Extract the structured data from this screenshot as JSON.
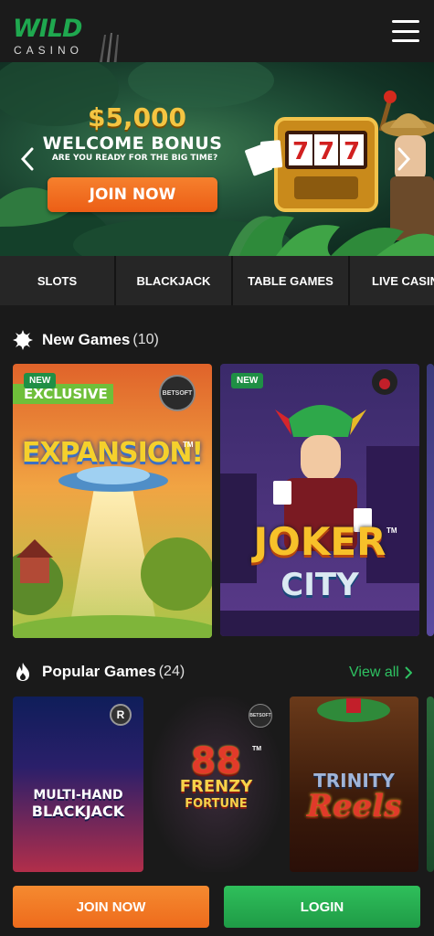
{
  "header": {
    "logo_wild": "WILD",
    "logo_casino": "CASINO",
    "menu_icon": "hamburger-menu-icon"
  },
  "hero": {
    "amount": "$5,000",
    "title": "WELCOME BONUS",
    "subtitle": "ARE YOU READY FOR THE BIG TIME?",
    "join_label": "JOIN NOW",
    "slot_reels": "777"
  },
  "tabs": [
    {
      "label": "SLOTS"
    },
    {
      "label": "BLACKJACK"
    },
    {
      "label": "TABLE GAMES"
    },
    {
      "label": "LIVE CASINO"
    }
  ],
  "new_games": {
    "title": "New Games",
    "count": "(10)",
    "icon": "starburst-icon",
    "cards": [
      {
        "badge": "NEW",
        "ribbon": "EXCLUSIVE",
        "provider": "BETSOFT",
        "title": "EXPANSION!",
        "tm": "TM"
      },
      {
        "badge": "NEW",
        "title_top": "JOKER",
        "title_bottom": "CITY",
        "tm": "TM"
      }
    ]
  },
  "popular_games": {
    "title": "Popular Games",
    "count": "(24)",
    "icon": "fire-icon",
    "view_all": "View all",
    "cards": [
      {
        "title_top": "MULTI-HAND",
        "title_bottom": "BLACKJACK",
        "provider": "R"
      },
      {
        "title_top": "88",
        "title_mid": "FRENZY",
        "title_bottom": "FORTUNE",
        "provider": "BETSOFT",
        "tm": "TM"
      },
      {
        "title_top": "TRINITY",
        "title_bottom": "Reels"
      }
    ]
  },
  "bottom": {
    "join_label": "JOIN NOW",
    "login_label": "LOGIN"
  },
  "colors": {
    "brand_green": "#1fa84f",
    "accent_orange": "#ee6b1c",
    "background": "#1a1a1a"
  }
}
